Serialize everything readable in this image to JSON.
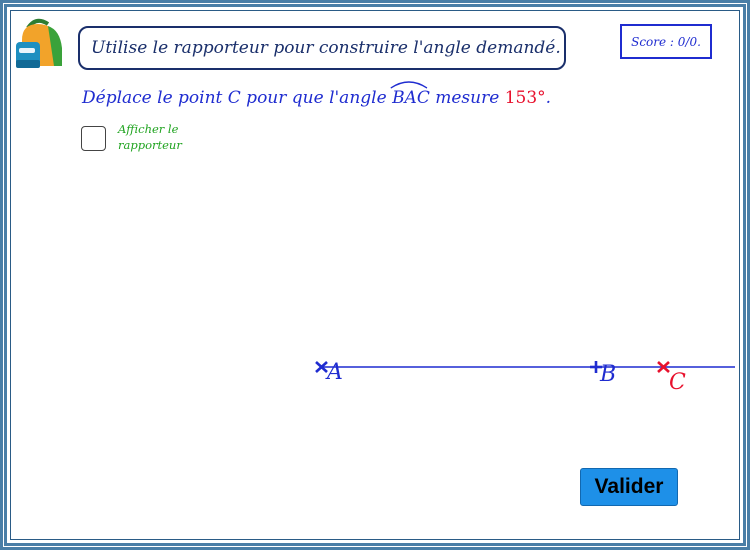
{
  "header": {
    "title": "Utilise le rapporteur pour construire l'angle demandé.",
    "score": "Score : 0/0."
  },
  "instruction": {
    "prefix": "Déplace le point C pour que l'angle ",
    "angle_name": "BAC",
    "middle": " mesure ",
    "degree": "153°",
    "suffix": "."
  },
  "protractor_toggle": {
    "label_line1": "Afficher le",
    "label_line2": "rapporteur",
    "checked": false
  },
  "points": {
    "A": "A",
    "B": "B",
    "C": "C"
  },
  "buttons": {
    "valider": "Valider"
  },
  "colors": {
    "frame": "#4a7ea6",
    "title_text": "#1a2f6b",
    "blue": "#1f2cd0",
    "red": "#e8112d",
    "green": "#1fa31f",
    "button": "#1e90e8"
  },
  "icons": {
    "app_icon": "backpack-icon"
  }
}
